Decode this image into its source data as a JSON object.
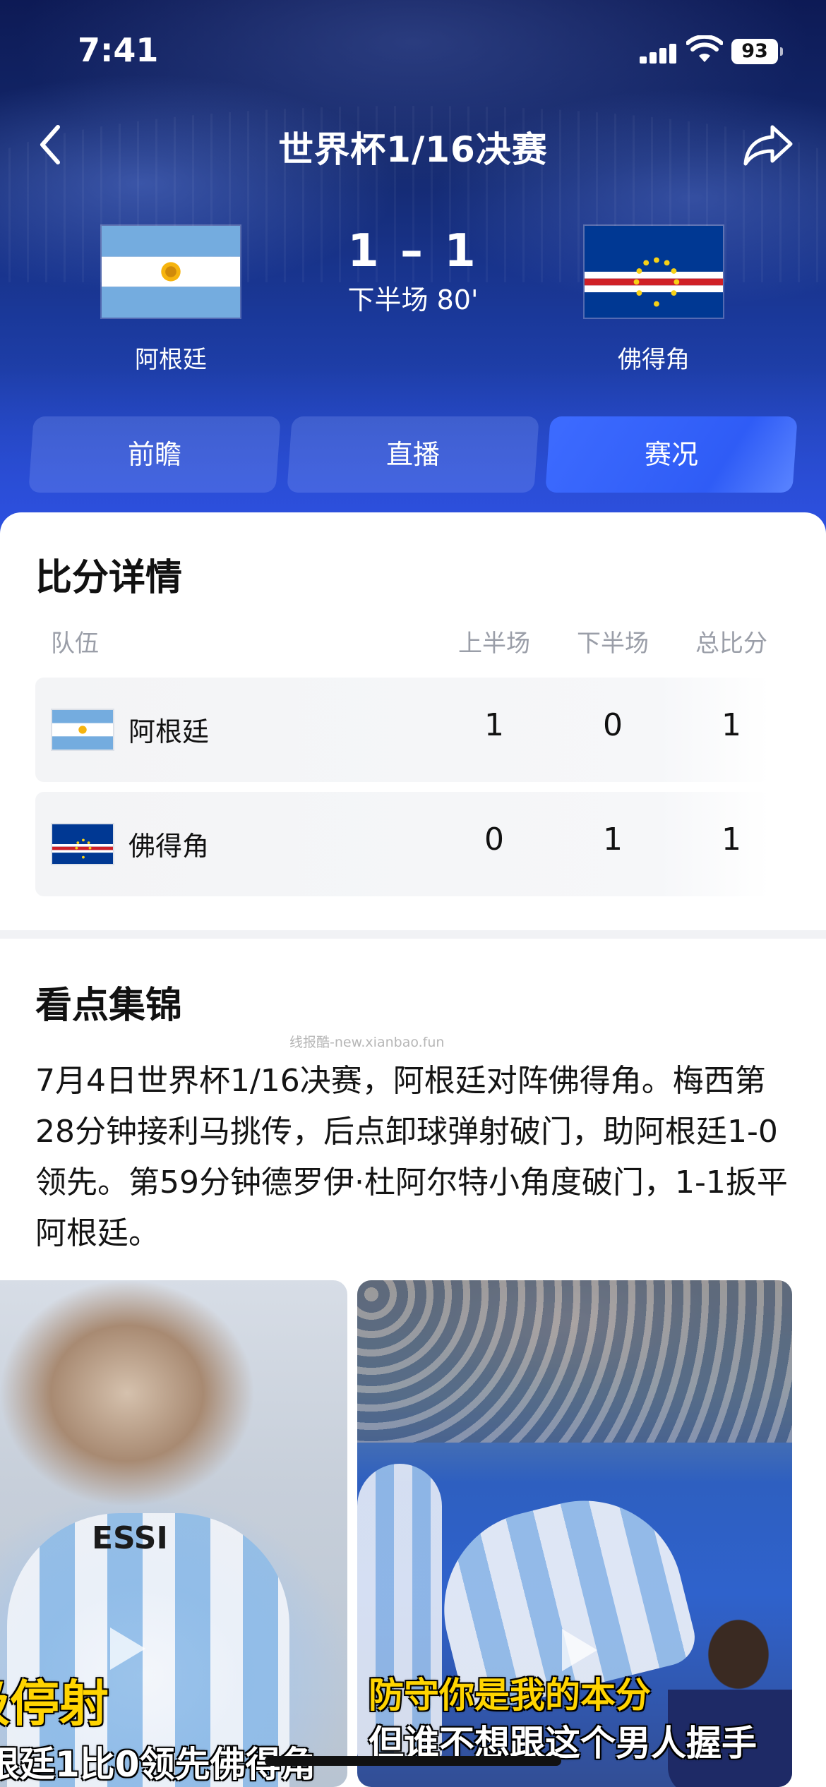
{
  "status_bar": {
    "time": "7:41",
    "battery": "93"
  },
  "header": {
    "title": "世界杯1/16决赛",
    "home_team": "阿根廷",
    "away_team": "佛得角",
    "score": "1 – 1",
    "match_status": "下半场 80'"
  },
  "tabs": [
    {
      "label": "前瞻",
      "active": false
    },
    {
      "label": "直播",
      "active": false
    },
    {
      "label": "赛况",
      "active": true
    }
  ],
  "score_details": {
    "title": "比分详情",
    "columns": [
      "队伍",
      "上半场",
      "下半场",
      "总比分"
    ],
    "rows": [
      {
        "team": "阿根廷",
        "first_half": "1",
        "second_half": "0",
        "total": "1"
      },
      {
        "team": "佛得角",
        "first_half": "0",
        "second_half": "1",
        "total": "1"
      }
    ]
  },
  "highlights": {
    "title": "看点集锦",
    "watermark": "线报酷-new.xianbao.fun",
    "description": "7月4日世界杯1/16决赛，阿根廷对阵佛得角。梅西第28分钟接利马挑传，后点卸球弹射破门，助阿根廷1-0领先。第59分钟德罗伊·杜阿尔特小角度破门，1-1扳平阿根廷。",
    "videos": [
      {
        "caption_top": "级停射",
        "caption_bottom": "根廷1比0领先佛得角",
        "jersey_text": "ESSI"
      },
      {
        "caption_top": "防守你是我的本分",
        "caption_bottom": "但谁不想跟这个男人握手"
      }
    ]
  },
  "colors": {
    "header_dark": "#0d1a55",
    "header_blue": "#2a4fd2",
    "active_tab": "#3d6bff",
    "caption_yellow": "#ffd400"
  },
  "icons": [
    "back-icon",
    "share-icon",
    "signal-icon",
    "wifi-icon",
    "battery-icon",
    "play-icon"
  ]
}
